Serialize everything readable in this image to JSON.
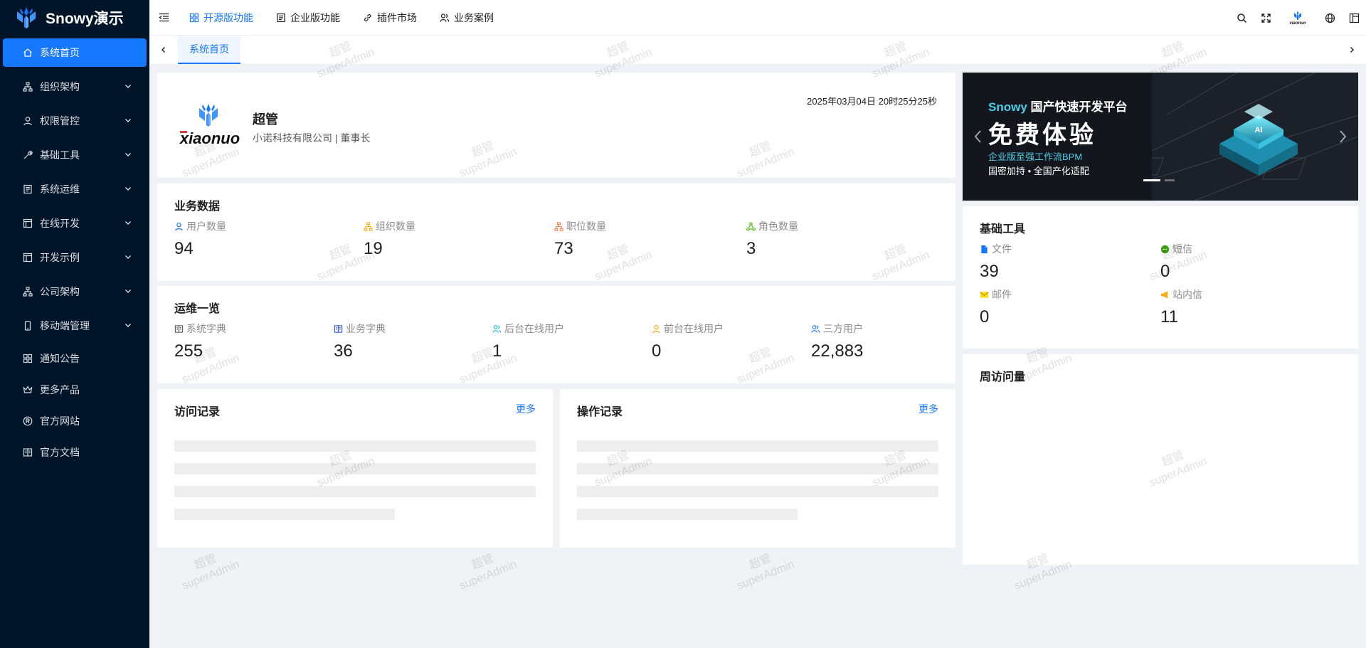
{
  "app": {
    "title": "Snowy演示"
  },
  "sidebar": {
    "items": [
      {
        "label": "系统首页",
        "icon": "home-icon",
        "expandable": false,
        "active": true
      },
      {
        "label": "组织架构",
        "icon": "org-icon",
        "expandable": true
      },
      {
        "label": "权限管控",
        "icon": "user-icon",
        "expandable": true
      },
      {
        "label": "基础工具",
        "icon": "tool-icon",
        "expandable": true
      },
      {
        "label": "系统运维",
        "icon": "server-icon",
        "expandable": true
      },
      {
        "label": "在线开发",
        "icon": "code-icon",
        "expandable": true
      },
      {
        "label": "开发示例",
        "icon": "layout-icon",
        "expandable": true
      },
      {
        "label": "公司架构",
        "icon": "org-icon",
        "expandable": true
      },
      {
        "label": "移动端管理",
        "icon": "mobile-icon",
        "expandable": true
      },
      {
        "label": "通知公告",
        "icon": "grid-icon",
        "expandable": false
      },
      {
        "label": "更多产品",
        "icon": "crown-icon",
        "expandable": false
      },
      {
        "label": "官方网站",
        "icon": "registered-icon",
        "expandable": false
      },
      {
        "label": "官方文档",
        "icon": "book-icon",
        "expandable": false
      }
    ]
  },
  "header": {
    "nav": [
      {
        "label": "开源版功能",
        "icon": "apps-icon",
        "active": true
      },
      {
        "label": "企业版功能",
        "icon": "file-icon"
      },
      {
        "label": "插件市场",
        "icon": "link-icon"
      },
      {
        "label": "业务案例",
        "icon": "team-icon"
      }
    ],
    "avatar_text": "xiaonuo"
  },
  "tabs": [
    {
      "label": "系统首页"
    }
  ],
  "user_card": {
    "name": "超管",
    "org": "小诺科技有限公司 | 董事长",
    "datetime": "2025年03月04日 20时25分25秒",
    "logo_text": "xiaonuo"
  },
  "biz_data": {
    "title": "业务数据",
    "stats": [
      {
        "label": "用户数量",
        "value": "94",
        "color": "#1677ff",
        "icon": "user-icon"
      },
      {
        "label": "组织数量",
        "value": "19",
        "color": "#faad14",
        "icon": "org-icon"
      },
      {
        "label": "职位数量",
        "value": "73",
        "color": "#ff7a45",
        "icon": "org-icon"
      },
      {
        "label": "角色数量",
        "value": "3",
        "color": "#52c41a",
        "icon": "cluster-icon"
      }
    ]
  },
  "ops_data": {
    "title": "运维一览",
    "stats": [
      {
        "label": "系统字典",
        "value": "255",
        "color": "#595959",
        "icon": "book-icon"
      },
      {
        "label": "业务字典",
        "value": "36",
        "color": "#2f54eb",
        "icon": "book-icon"
      },
      {
        "label": "后台在线用户",
        "value": "1",
        "color": "#13c2c2",
        "icon": "team-icon"
      },
      {
        "label": "前台在线用户",
        "value": "0",
        "color": "#faad14",
        "icon": "user-icon"
      },
      {
        "label": "三方用户",
        "value": "22,883",
        "color": "#1677ff",
        "icon": "team-icon"
      }
    ]
  },
  "visit_log": {
    "title": "访问记录",
    "more": "更多"
  },
  "op_log": {
    "title": "操作记录",
    "more": "更多"
  },
  "banner": {
    "title_brand": "Snowy",
    "title_rest": " 国产快速开发平台",
    "big": "免费体验",
    "sub": "企业版至强工作流BPM",
    "sub2": "国密加持 • 全国产化适配"
  },
  "tools": {
    "title": "基础工具",
    "items": [
      {
        "label": "文件",
        "value": "39",
        "color": "#1677ff",
        "icon": "file-icon"
      },
      {
        "label": "短信",
        "value": "0",
        "color": "#52c41a",
        "icon": "message-icon"
      },
      {
        "label": "邮件",
        "value": "0",
        "color": "#fadb14",
        "icon": "mail-icon"
      },
      {
        "label": "站内信",
        "value": "11",
        "color": "#faad14",
        "icon": "notification-icon"
      }
    ]
  },
  "weekly": {
    "title": "周访问量"
  },
  "watermark": {
    "line1": "超管",
    "line2": "superAdmin"
  }
}
